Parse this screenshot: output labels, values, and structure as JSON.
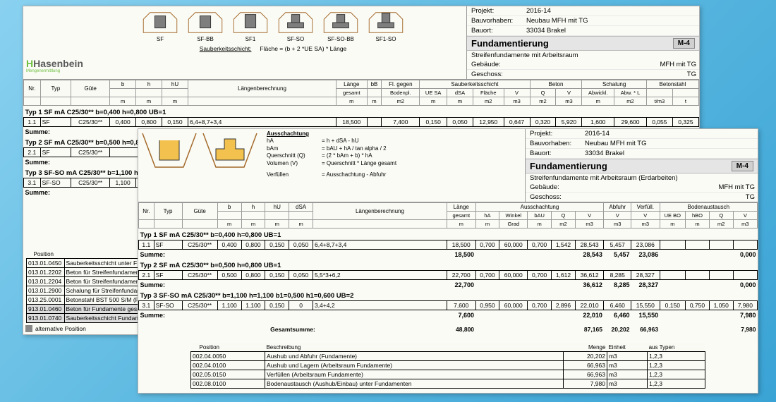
{
  "report1": {
    "logo_main": "Hasenbein",
    "logo_sub": "Mengenermittlung",
    "diagram_labels": [
      "SF",
      "SF-BB",
      "SF1",
      "SF-SO",
      "SF-SO-BB",
      "SF1-SO"
    ],
    "sauber_label": "Sauberkeitsschicht:",
    "sauber_formula": "Fläche = (b + 2 *UE SA) * Länge",
    "meta": {
      "projekt_l": "Projekt:",
      "projekt_v": "2016-14",
      "bauvor_l": "Bauvorhaben:",
      "bauvor_v": "Neubau MFH mit TG",
      "bauort_l": "Bauort:",
      "bauort_v": "33034 Brakel",
      "title": "Fundamentierung",
      "subtitle": "Streifenfundamente mit Arbeitsraum",
      "badge": "M-4",
      "geb_l": "Gebäude:",
      "geb_v": "MFH mit TG",
      "ges_l": "Geschoss:",
      "ges_v": "TG"
    },
    "cols": {
      "nr": "Nr.",
      "typ": "Typ",
      "guete": "Güte",
      "b": "b",
      "h": "h",
      "hu": "hU",
      "laengen": "Längenberechnung",
      "laenge": "Länge",
      "bB": "bB",
      "flgeg": "Fl. gegen",
      "sauber": "Sauberkeitsschicht",
      "beton": "Beton",
      "schalung": "Schalung",
      "betonstahl": "Betonstahl",
      "gesamt": "gesamt",
      "boden": "Bodenpl.",
      "uesa": "UE SA",
      "dsa": "dSA",
      "flaeche": "Fläche",
      "v": "V",
      "q": "Q",
      "abw": "Abwickl.",
      "abwl": "Abw. * L",
      "m": "m",
      "m2": "m2",
      "m3": "m3",
      "tm3": "t/m3",
      "t": "t"
    },
    "typ1_hdr": "Typ  1   SF mA C25/30** b=0,400 h=0,800 UB=1",
    "typ1_row": {
      "nr": "1.1",
      "typ": "SF",
      "guete": "C25/30**",
      "b": "0,400",
      "h": "0,800",
      "hu": "0,150",
      "lb": "6,4+8,7+3,4",
      "laenge": "18,500",
      "bB": "7,400",
      "uesa": "0,150",
      "dsa": "0,050",
      "flaeche": "12,950",
      "v1": "0,647",
      "q": "0,320",
      "v2": "5,920",
      "abw": "1,600",
      "abwl": "29,600",
      "tm3": "0,055",
      "t": "0,325"
    },
    "typ2_hdr": "Typ  2   SF mA C25/30** b=0,500 h=0,8",
    "typ2_row": {
      "nr": "2.1",
      "typ": "SF",
      "guete": "C25/30**"
    },
    "typ3_hdr": "Typ  3   SF-SO mA C25/30** b=1,100 h",
    "typ3_row": {
      "nr": "3.1",
      "typ": "SF-SO",
      "guete": "C25/30**",
      "b": "1,100"
    },
    "summe": "Summe:",
    "pos_hdr": "Position",
    "positions": [
      {
        "nr": "013.01.0450",
        "txt": "Sauberkeitsschicht unter F"
      },
      {
        "nr": "013.01.2202",
        "txt": "Beton für Streifenfundament"
      },
      {
        "nr": "013.01.2204",
        "txt": "Beton für Streifenfundament"
      },
      {
        "nr": "013.01.2900",
        "txt": "Schalung für Streifenfundam"
      },
      {
        "nr": "013.25.0001",
        "txt": "Betonstahl BST 500 S/M (F"
      },
      {
        "nr": "913.01.0460",
        "txt": "Beton für Fundamente gesa"
      },
      {
        "nr": "913.01.0740",
        "txt": "Sauberkeitsschicht Fundam"
      }
    ],
    "alt_pos": "alternative Position"
  },
  "report2": {
    "ann": {
      "title": "Ausschachtung",
      "hA_l": "hA",
      "hA_v": "= h + dSA - hU",
      "bAm_l": "bAm",
      "bAm_v": "= bAU + hA / tan alpha / 2",
      "quer_l": "Querschnitt (Q)",
      "quer_v": "= (2 * bAm + b) * hA",
      "vol_l": "Volumen (V)",
      "vol_v": "= Querschnitt * Länge gesamt",
      "verf_l": "Verfüllen",
      "verf_v": "= Ausschachtung - Abfuhr"
    },
    "meta": {
      "projekt_l": "Projekt:",
      "projekt_v": "2016-14",
      "bauvor_l": "Bauvorhaben:",
      "bauvor_v": "Neubau MFH mit TG",
      "bauort_l": "Bauort:",
      "bauort_v": "33034 Brakel",
      "title": "Fundamentierung",
      "subtitle": "Streifenfundamente mit Arbeitsraum (Erdarbeiten)",
      "badge": "M-4",
      "geb_l": "Gebäude:",
      "geb_v": "MFH mit TG",
      "ges_l": "Geschoss:",
      "ges_v": "TG"
    },
    "cols": {
      "nr": "Nr.",
      "typ": "Typ",
      "guete": "Güte",
      "b": "b",
      "h": "h",
      "hu": "hU",
      "dsa": "dSA",
      "laengen": "Längenberechnung",
      "laenge": "Länge",
      "aus": "Ausschachtung",
      "abf": "Abfuhr",
      "verf": "Verfüll.",
      "boden": "Bodenaustausch",
      "gesamt": "gesamt",
      "hA": "hA",
      "winkel": "Winkel",
      "bAU": "bAU",
      "q": "Q",
      "v": "V",
      "uebo": "UE BO",
      "hbo": "hBO",
      "m": "m",
      "m2": "m2",
      "m3": "m3",
      "grad": "Grad"
    },
    "typ1_hdr": "Typ  1   SF mA C25/30** b=0,400 h=0,800 UB=1",
    "typ1_row": {
      "nr": "1.1",
      "typ": "SF",
      "guete": "C25/30**",
      "b": "0,400",
      "h": "0,800",
      "hu": "0,150",
      "dsa": "0,050",
      "lb": "6,4+8,7+3,4",
      "laenge": "18,500",
      "hA": "0,700",
      "winkel": "60,000",
      "bAU": "0,700",
      "q": "1,542",
      "v": "28,543",
      "abf": "5,457",
      "verf": "23,086"
    },
    "typ1_sum": {
      "laenge": "18,500",
      "v": "28,543",
      "abf": "5,457",
      "verf": "23,086",
      "bo": "0,000"
    },
    "typ2_hdr": "Typ  2   SF mA C25/30** b=0,500 h=0,800 UB=1",
    "typ2_row": {
      "nr": "2.1",
      "typ": "SF",
      "guete": "C25/30**",
      "b": "0,500",
      "h": "0,800",
      "hu": "0,150",
      "dsa": "0,050",
      "lb": "5,5*3+6,2",
      "laenge": "22,700",
      "hA": "0,700",
      "winkel": "60,000",
      "bAU": "0,700",
      "q": "1,612",
      "v": "36,612",
      "abf": "8,285",
      "verf": "28,327"
    },
    "typ2_sum": {
      "laenge": "22,700",
      "v": "36,612",
      "abf": "8,285",
      "verf": "28,327",
      "bo": "0,000"
    },
    "typ3_hdr": "Typ  3   SF-SO mA C25/30** b=1,100 h=1,100 b1=0,500 h1=0,600 UB=2",
    "typ3_row": {
      "nr": "3.1",
      "typ": "SF-SO",
      "guete": "C25/30**",
      "b": "1,100",
      "h": "1,100",
      "hu": "0,150",
      "dsa": "0",
      "lb": "3,4+4,2",
      "laenge": "7,600",
      "hA": "0,950",
      "winkel": "60,000",
      "bAU": "0,700",
      "q": "2,896",
      "v": "22,010",
      "abf": "6,460",
      "verf": "15,550",
      "uebo": "0,150",
      "hbo": "0,750",
      "bq": "1,050",
      "bv": "7,980"
    },
    "typ3_sum": {
      "laenge": "7,600",
      "v": "22,010",
      "abf": "6,460",
      "verf": "15,550",
      "bo": "7,980"
    },
    "summe": "Summe:",
    "grand_l": "Gesamtsumme:",
    "grand": {
      "laenge": "48,800",
      "v": "87,165",
      "abf": "20,202",
      "verf": "66,963",
      "bo": "7,980"
    },
    "pos_cols": {
      "pos": "Position",
      "besch": "Beschreibung",
      "menge": "Menge",
      "einheit": "Einheit",
      "typen": "aus Typen"
    },
    "positions": [
      {
        "nr": "002.04.0050",
        "txt": "Aushub und Abfuhr (Fundamente)",
        "menge": "20,202",
        "einh": "m3",
        "typ": "1,2,3"
      },
      {
        "nr": "002.04.0100",
        "txt": "Aushub und Lagern (Arbeitsraum Fundamente)",
        "menge": "66,963",
        "einh": "m3",
        "typ": "1,2,3"
      },
      {
        "nr": "002.05.0150",
        "txt": "Verfüllen (Arbeitsraum Fundamente)",
        "menge": "66,963",
        "einh": "m3",
        "typ": "1,2,3"
      },
      {
        "nr": "002.08.0100",
        "txt": "Bodenaustausch (Aushub/Einbau) unter Fundamenten",
        "menge": "7,980",
        "einh": "m3",
        "typ": "1,2,3"
      }
    ]
  }
}
